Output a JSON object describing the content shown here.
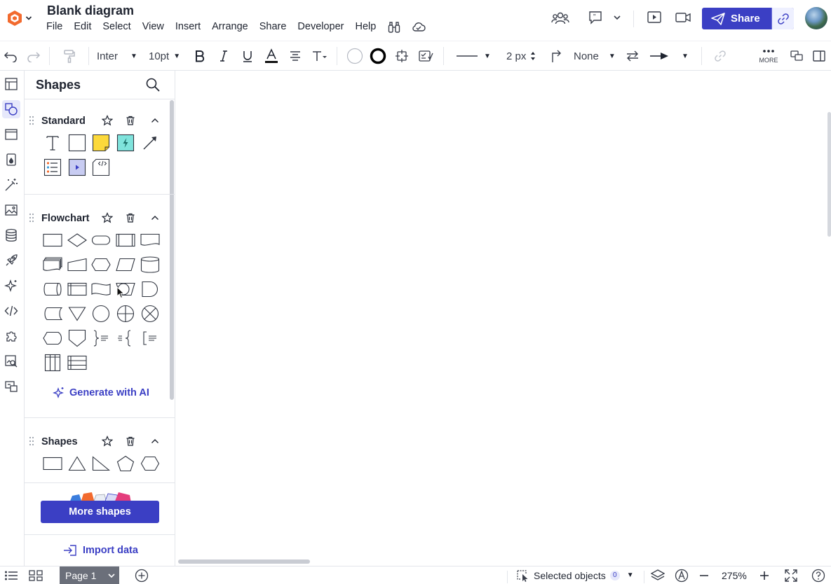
{
  "document": {
    "title": "Blank diagram"
  },
  "menu": [
    "File",
    "Edit",
    "Select",
    "View",
    "Insert",
    "Arrange",
    "Share",
    "Developer",
    "Help"
  ],
  "header": {
    "share_label": "Share"
  },
  "toolbar": {
    "font_family": "Inter",
    "font_size": "10pt",
    "line_width": "2 px",
    "line_end_left": "None",
    "more_label": "MORE"
  },
  "panel": {
    "title": "Shapes",
    "sections": {
      "standard": "Standard",
      "flowchart": "Flowchart",
      "shapes": "Shapes"
    },
    "generate_ai": "Generate with AI",
    "more_shapes": "More shapes",
    "import_data": "Import data"
  },
  "bottom": {
    "page_label": "Page 1",
    "selected_label": "Selected objects",
    "selected_count": "0",
    "zoom": "275%"
  },
  "colors": {
    "accent": "#3b3fc4",
    "note_yellow": "#fcd93b",
    "action_teal": "#7fe3dc",
    "logo_orange": "#f26a2e"
  }
}
